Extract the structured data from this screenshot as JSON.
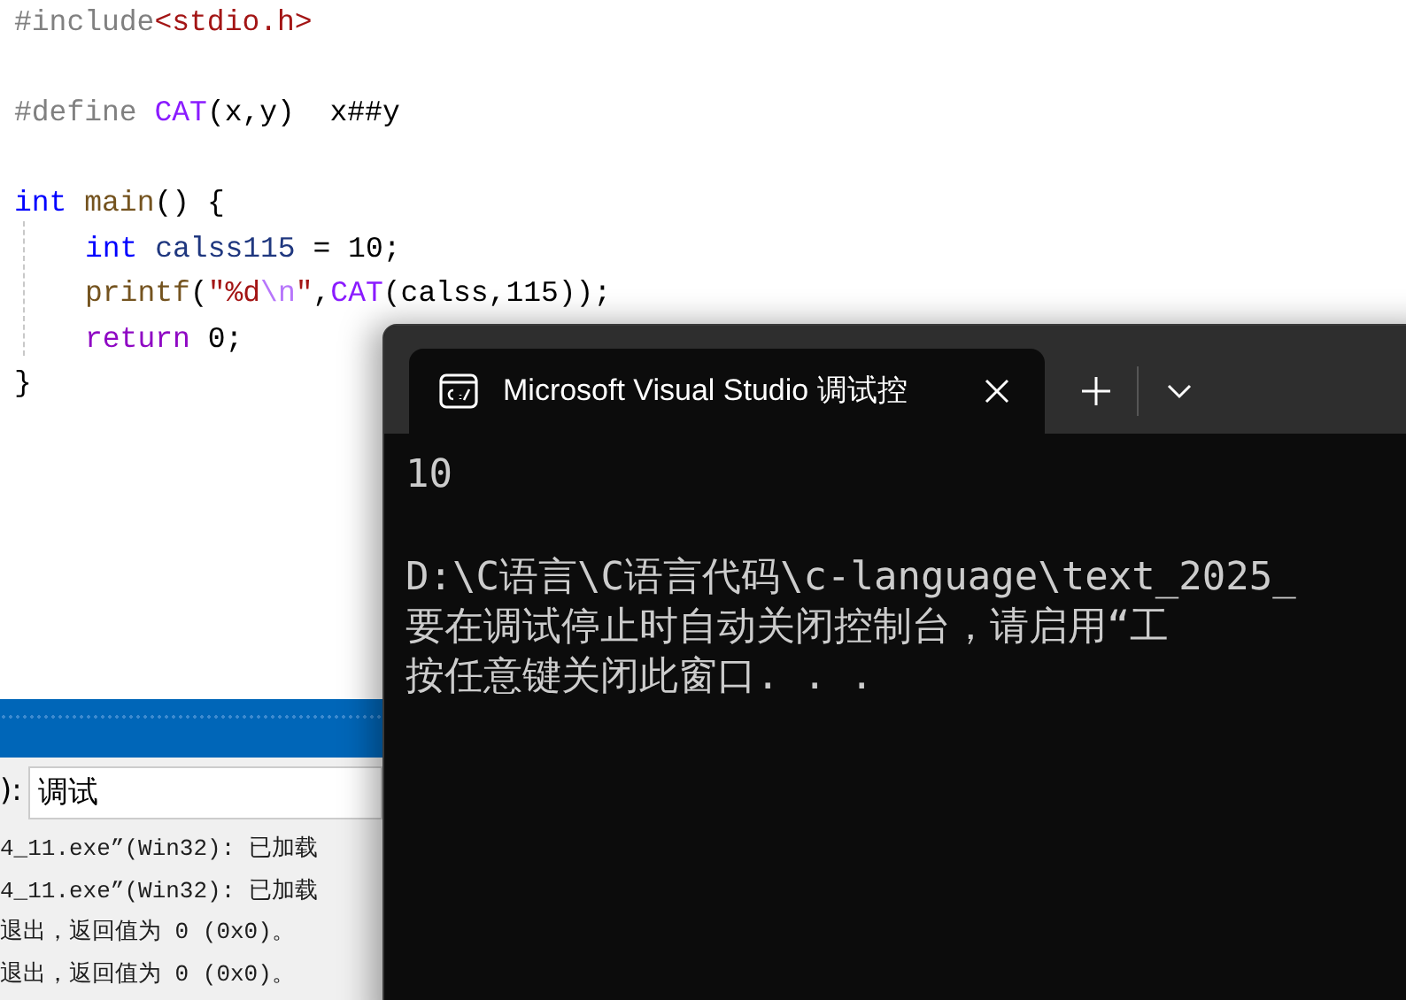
{
  "editor": {
    "lines": [
      {
        "blank_before": false,
        "indented": false,
        "tokens": [
          {
            "text": "#include",
            "kind": "preproc"
          },
          {
            "text": "<stdio.h>",
            "kind": "string"
          }
        ]
      },
      {
        "blank_before": true,
        "indented": false,
        "tokens": [
          {
            "text": "#define ",
            "kind": "preproc"
          },
          {
            "text": "CAT",
            "kind": "macro"
          },
          {
            "text": "(x,y)  x##y",
            "kind": "plain"
          }
        ]
      },
      {
        "blank_before": true,
        "indented": false,
        "tokens": [
          {
            "text": "int",
            "kind": "keyword"
          },
          {
            "text": " main",
            "kind": "function"
          },
          {
            "text": "() {",
            "kind": "plain"
          }
        ]
      },
      {
        "blank_before": false,
        "indented": true,
        "tokens": [
          {
            "text": "int",
            "kind": "keyword"
          },
          {
            "text": " calss115",
            "kind": "variable"
          },
          {
            "text": " = 10;",
            "kind": "plain"
          }
        ]
      },
      {
        "blank_before": false,
        "indented": true,
        "tokens": [
          {
            "text": "printf",
            "kind": "function"
          },
          {
            "text": "(",
            "kind": "plain"
          },
          {
            "text": "\"%d",
            "kind": "string"
          },
          {
            "text": "\\n",
            "kind": "escape"
          },
          {
            "text": "\"",
            "kind": "string"
          },
          {
            "text": ",",
            "kind": "plain"
          },
          {
            "text": "CAT",
            "kind": "macro"
          },
          {
            "text": "(calss,115));",
            "kind": "plain"
          }
        ]
      },
      {
        "blank_before": false,
        "indented": true,
        "tokens": [
          {
            "text": "return",
            "kind": "control"
          },
          {
            "text": " 0;",
            "kind": "plain"
          }
        ]
      },
      {
        "blank_before": false,
        "indented": false,
        "tokens": [
          {
            "text": "}",
            "kind": "plain"
          }
        ]
      }
    ]
  },
  "output_panel": {
    "source_label": "):",
    "source_value": "调试",
    "lines": [
      "4_11.exe”(Win32): 已加载",
      "4_11.exe”(Win32): 已加载",
      "退出，返回值为 0 (0x0)。",
      "退出，返回值为 0 (0x0)。"
    ]
  },
  "terminal": {
    "tab_title": "Microsoft Visual Studio 调试控",
    "lines": [
      {
        "text": "10",
        "blank_before": false
      },
      {
        "text": "D:\\C语言\\C语言代码\\c-language\\text_2025_",
        "blank_before": true
      },
      {
        "text": "要在调试停止时自动关闭控制台，请启用“工",
        "blank_before": false
      },
      {
        "text": "按任意键关闭此窗口. . .",
        "blank_before": false
      }
    ]
  }
}
